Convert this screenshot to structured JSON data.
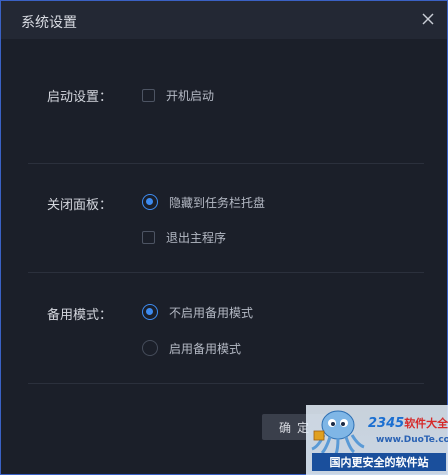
{
  "window": {
    "title": "系统设置",
    "close_icon": "close-icon"
  },
  "startup": {
    "label": "启动设置：",
    "options": [
      {
        "text": "开机启动",
        "checked": false
      }
    ]
  },
  "close_panel": {
    "label": "关闭面板：",
    "options": [
      {
        "text": "隐藏到任务栏托盘",
        "selected": true
      },
      {
        "text": "退出主程序",
        "checked": false
      }
    ]
  },
  "backup_mode": {
    "label": "备用模式：",
    "options": [
      {
        "text": "不启用备用模式",
        "selected": true
      },
      {
        "text": "启用备用模式",
        "selected": false
      }
    ]
  },
  "footer": {
    "confirm_label": "确定"
  },
  "watermark": {
    "brand_num": "2345",
    "brand_text": "软件大全",
    "url": "www.DuoTe.com",
    "slogan": "国内更安全的软件站"
  },
  "colors": {
    "accent": "#3d8bf0",
    "border": "#3a61c4",
    "background": "#1b1f29"
  }
}
